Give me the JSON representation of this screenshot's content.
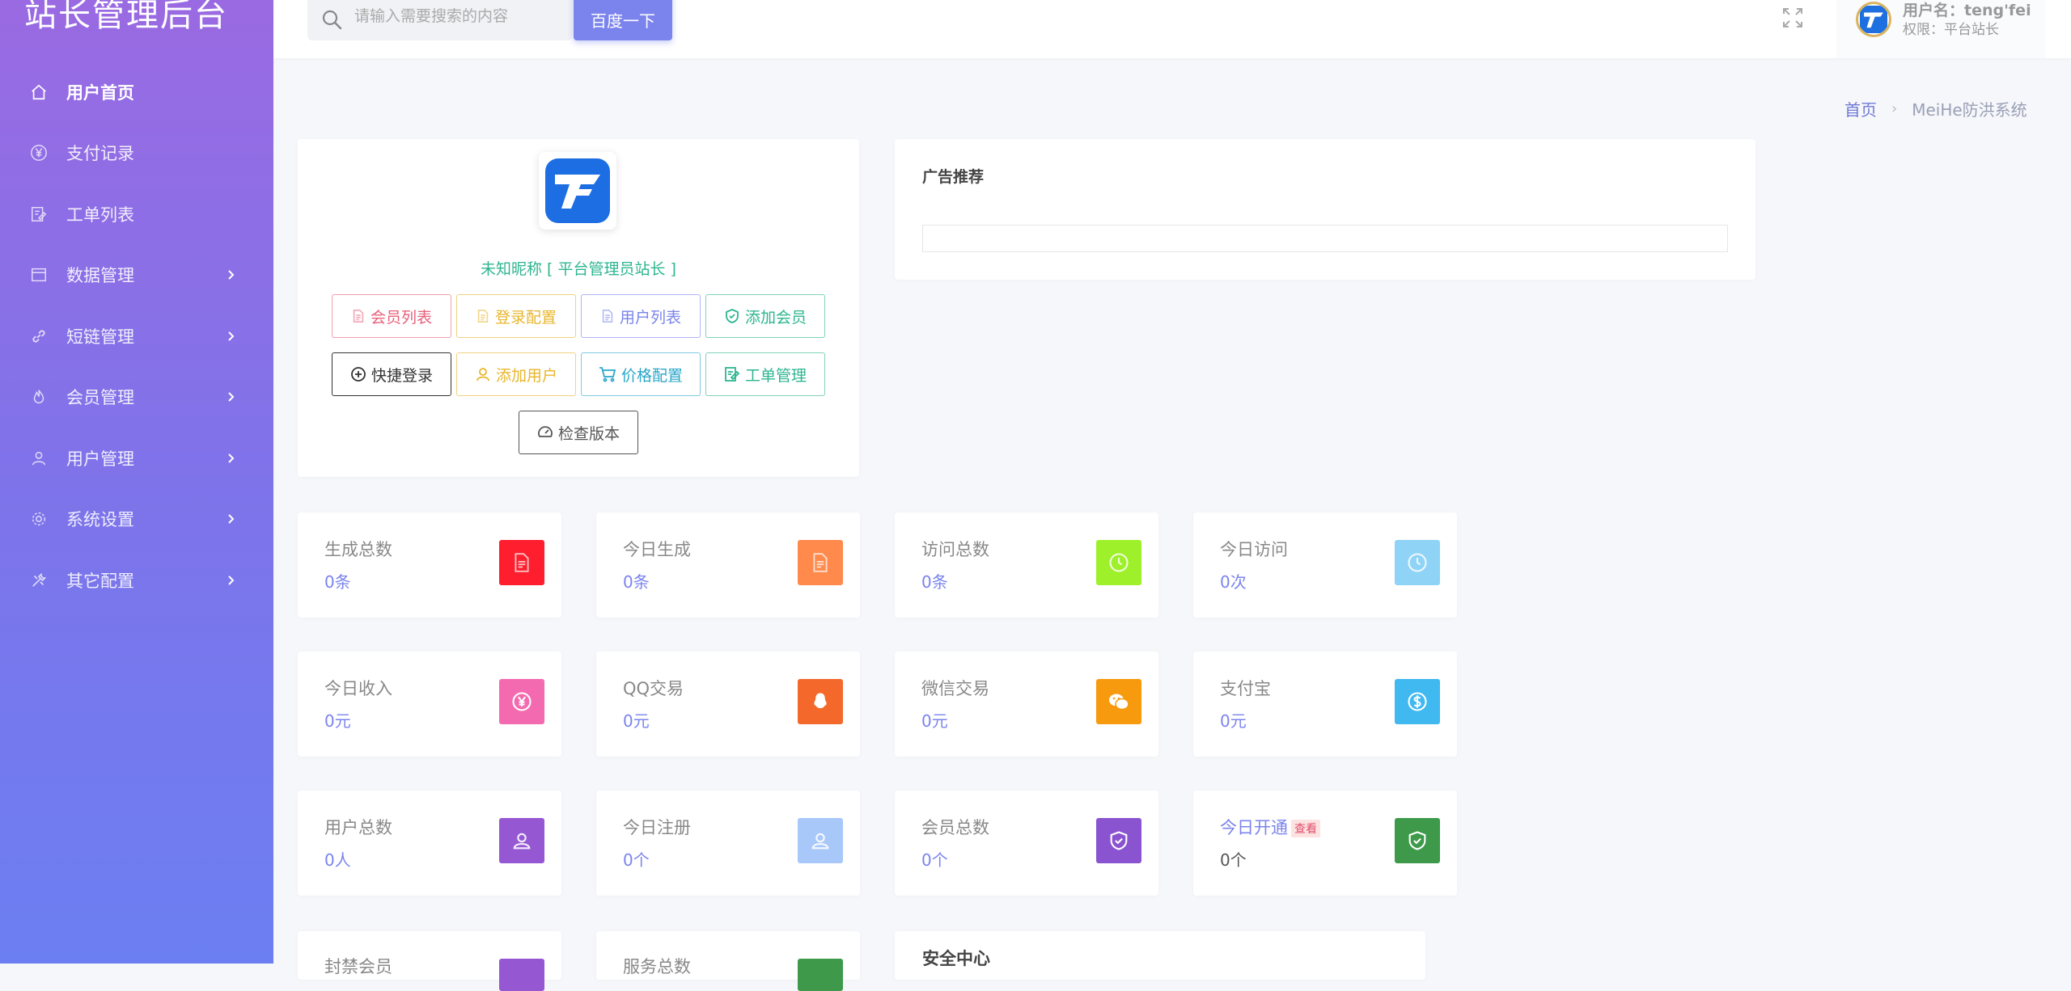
{
  "app": {
    "title": "站长管理后台"
  },
  "sidebar": {
    "items": [
      {
        "label": "用户首页",
        "icon": "home-icon",
        "active": true,
        "has_submenu": false
      },
      {
        "label": "支付记录",
        "icon": "yen-icon",
        "active": false,
        "has_submenu": false
      },
      {
        "label": "工单列表",
        "icon": "edit-icon",
        "active": false,
        "has_submenu": false
      },
      {
        "label": "数据管理",
        "icon": "browser-icon",
        "active": false,
        "has_submenu": true
      },
      {
        "label": "短链管理",
        "icon": "link-icon",
        "active": false,
        "has_submenu": true
      },
      {
        "label": "会员管理",
        "icon": "fire-icon",
        "active": false,
        "has_submenu": true
      },
      {
        "label": "用户管理",
        "icon": "user-icon",
        "active": false,
        "has_submenu": true
      },
      {
        "label": "系统设置",
        "icon": "gear-icon",
        "active": false,
        "has_submenu": true
      },
      {
        "label": "其它配置",
        "icon": "tools-icon",
        "active": false,
        "has_submenu": true
      }
    ]
  },
  "topbar": {
    "search_placeholder": "请输入需要搜索的内容",
    "search_button": "百度一下",
    "user_name": "用户名：teng'fei",
    "user_role": "权限：平台站长"
  },
  "breadcrumb": {
    "home": "首页",
    "current": "MeiHe防洪系统"
  },
  "profile": {
    "name": "未知昵称 [ 平台管理员站长 ]",
    "buttons": [
      {
        "label": "会员列表",
        "icon": "document-icon",
        "color": "#e8607a"
      },
      {
        "label": "登录配置",
        "icon": "document-icon",
        "color": "#e8b62c"
      },
      {
        "label": "用户列表",
        "icon": "document-icon",
        "color": "#7b84ec"
      },
      {
        "label": "添加会员",
        "icon": "shield-check-icon",
        "color": "#2db58f"
      },
      {
        "label": "快捷登录",
        "icon": "plus-circle-icon",
        "color": "#333333"
      },
      {
        "label": "添加用户",
        "icon": "user-icon",
        "color": "#e8b62c"
      },
      {
        "label": "价格配置",
        "icon": "cart-icon",
        "color": "#2aa6c9"
      },
      {
        "label": "工单管理",
        "icon": "edit-icon",
        "color": "#2db58f"
      },
      {
        "label": "检查版本",
        "icon": "speedometer-icon",
        "color": "#555555"
      }
    ]
  },
  "ad": {
    "title": "广告推荐"
  },
  "stats": [
    {
      "label": "生成总数",
      "value": "0条",
      "color": "#ff1e2e",
      "icon": "document-icon"
    },
    {
      "label": "今日生成",
      "value": "0条",
      "color": "#ff8a4c",
      "icon": "document-icon"
    },
    {
      "label": "访问总数",
      "value": "0条",
      "color": "#9ef02a",
      "icon": "clock-icon"
    },
    {
      "label": "今日访问",
      "value": "0次",
      "color": "#8fd3f7",
      "icon": "clock-icon"
    },
    {
      "label": "今日收入",
      "value": "0元",
      "color": "#f46ab0",
      "icon": "yen-icon"
    },
    {
      "label": "QQ交易",
      "value": "0元",
      "color": "#f4682c",
      "icon": "qq-icon"
    },
    {
      "label": "微信交易",
      "value": "0元",
      "color": "#f79a0e",
      "icon": "wechat-icon"
    },
    {
      "label": "支付宝",
      "value": "0元",
      "color": "#40b8f0",
      "icon": "dollar-icon"
    },
    {
      "label": "用户总数",
      "value": "0人",
      "color": "#9657d3",
      "icon": "users-icon"
    },
    {
      "label": "今日注册",
      "value": "0个",
      "color": "#a7c8f9",
      "icon": "users-icon"
    },
    {
      "label": "会员总数",
      "value": "0个",
      "color": "#8a54d0",
      "icon": "shield-check-icon"
    },
    {
      "label": "今日开通",
      "value": "0个",
      "color": "#3e9a4a",
      "icon": "shield-check-icon",
      "badge": "查看"
    }
  ],
  "partial_row": [
    {
      "label": "封禁会员",
      "color": "#9657d3"
    },
    {
      "label": "服务总数",
      "color": "#3e9a4a"
    }
  ],
  "security": {
    "title": "安全中心"
  }
}
